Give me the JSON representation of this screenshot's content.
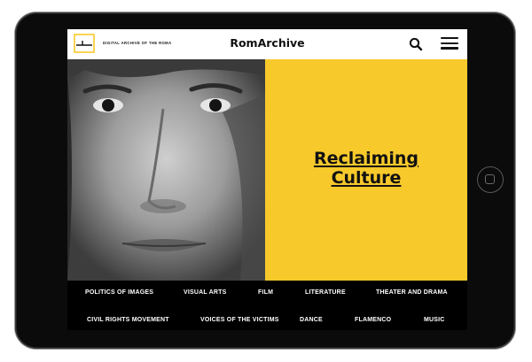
{
  "header": {
    "logo_tagline": "DIGITAL ARCHIVE OF THE ROMA",
    "brand": "RomArchive"
  },
  "icons": {
    "search": "search-icon",
    "menu": "hamburger-menu-icon",
    "logo": "romarchive-logo-icon",
    "home_button": "tablet-home-button-icon"
  },
  "hero": {
    "title_line1": "Reclaiming",
    "title_line2": "Culture"
  },
  "nav": {
    "row1": [
      "POLITICS OF IMAGES",
      "VISUAL ARTS",
      "FILM",
      "LITERATURE",
      "THEATER AND DRAMA"
    ],
    "row2": [
      "CIVIL RIGHTS MOVEMENT",
      "VOICES OF THE VICTIMS",
      "DANCE",
      "FLAMENCO",
      "MUSIC"
    ]
  },
  "colors": {
    "accent_yellow": "#f8c92b",
    "nav_background": "#000000",
    "header_background": "#ffffff",
    "tablet_bezel": "#0b0b0b"
  }
}
